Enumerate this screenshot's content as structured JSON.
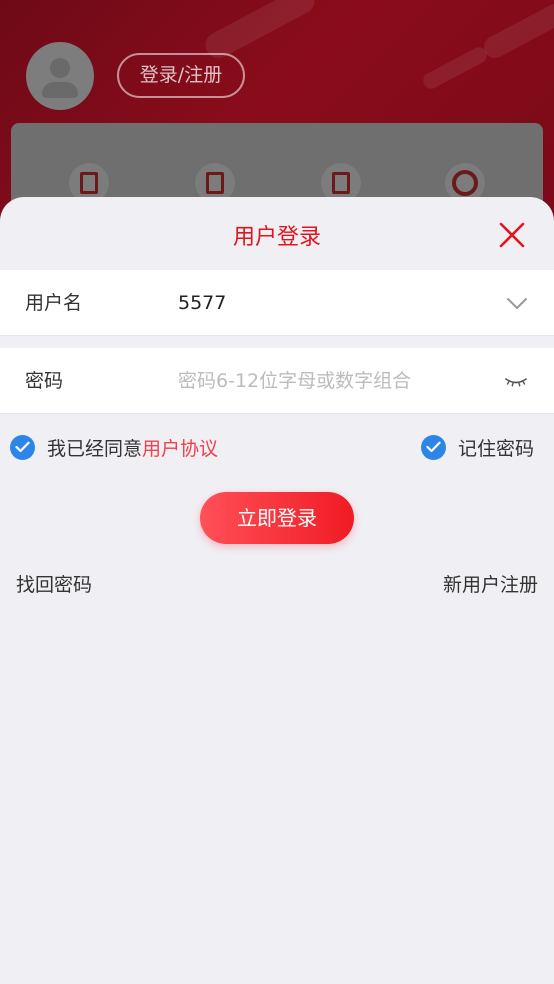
{
  "background": {
    "login_register_label": "登录/注册"
  },
  "dialog": {
    "title": "用户登录",
    "username": {
      "label": "用户名",
      "value": "5577"
    },
    "password": {
      "label": "密码",
      "value": "",
      "placeholder": "密码6-12位字母或数字组合"
    },
    "agreement": {
      "checked": true,
      "text": "我已经同意",
      "link": "用户协议"
    },
    "remember": {
      "checked": true,
      "text": "记住密码"
    },
    "login_button": "立即登录",
    "forgot_password": "找回密码",
    "register": "新用户注册"
  },
  "colors": {
    "accent": "#e0161e",
    "check": "#2b86e8",
    "link": "#f0404a"
  }
}
